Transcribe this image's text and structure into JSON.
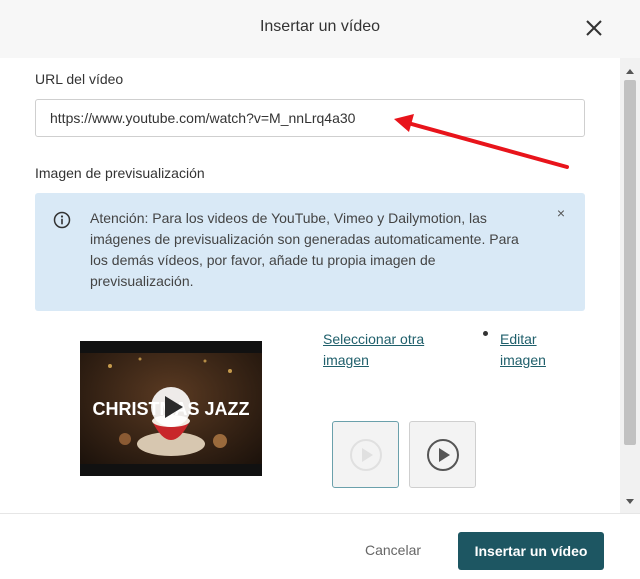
{
  "dialog": {
    "title": "Insertar un vídeo",
    "close_icon": "close-icon"
  },
  "url_section": {
    "label": "URL del vídeo",
    "input_value": "https://www.youtube.com/watch?v=M_nnLrq4a30"
  },
  "preview_section": {
    "label": "Imagen de previsualización",
    "notice": {
      "icon": "info-icon",
      "text": "Atención: Para los videos de YouTube, Vimeo y Dailymotion, las imágenes de previsualización son generadas automaticamente. Para los demás vídeos, por favor, añade tu propia imagen de previsualización.",
      "close_symbol": "×"
    },
    "thumbnail": {
      "overlay_text": "CHRISTMAS JAZZ"
    },
    "select_link": [
      "Seleccionar otra",
      "imagen"
    ],
    "edit_link": [
      "Editar",
      "imagen"
    ],
    "play_style_options": [
      "play-circle-icon-light",
      "play-circle-icon-dark"
    ]
  },
  "footer": {
    "cancel_label": "Cancelar",
    "insert_label": "Insertar un vídeo"
  },
  "colors": {
    "primary": "#1d5662",
    "notice_bg": "#d9e9f6",
    "link": "#1f5f6b",
    "annotation_arrow": "#e8141b"
  }
}
